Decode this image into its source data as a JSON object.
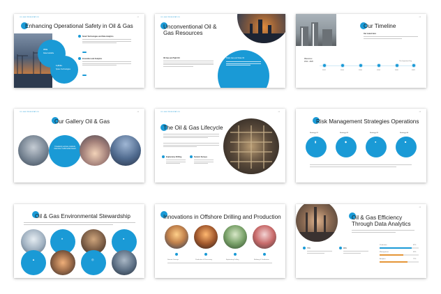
{
  "slides": [
    {
      "title": "Enhancing Operational Safety in Oil & Gas",
      "circle_a": {
        "value": "70%",
        "caption": "Data Available"
      },
      "circle_b": {
        "value": "1,212+",
        "caption": "Spare Technologies"
      },
      "points": [
        "Smart Technologies and Data Analytics",
        "Innovation and Analytics"
      ]
    },
    {
      "title": "Unconventional Oil & Gas Resources",
      "heading": "Oil Gas and Tight Oil",
      "circle_caption": "Shale Gas and Shale Oil"
    },
    {
      "title": "Our Timeline",
      "subtitle": "Our Latest Here",
      "milestone_label": "Milestones",
      "milestone_range": "2012 - 2026",
      "last_label": "The Important Day",
      "nodes": [
        "2012",
        "2014",
        "2016",
        "2018",
        "2020",
        "2022"
      ]
    },
    {
      "title": "Our Gallery Oil & Gas",
      "circle_text": "Creatively across markets intensive multimedia based"
    },
    {
      "title": "The Oil & Gas Lifecycle",
      "steps": [
        "Exploratory Drilling",
        "Production & Processing",
        "Seismic Surveys"
      ]
    },
    {
      "title": "Risk Management Strategies Operations",
      "strategies": [
        "Strategy 01",
        "Strategy 02",
        "Strategy 03",
        "Strategy 04"
      ]
    },
    {
      "title": "Oil & Gas Environmental Stewardship"
    },
    {
      "title": "Innovations in Offshore Drilling and Production",
      "captions": [
        "Seismic Surveys",
        "Production & Processing",
        "Exploratory Drilling",
        "Refining & Distribution"
      ]
    },
    {
      "title": "Oil & Gas Efficiency Through Data Analytics",
      "stats": [
        "70%",
        "90%"
      ],
      "bars": [
        {
          "label": "Production",
          "value": 0.82,
          "text": "82%"
        },
        {
          "label": "Management",
          "value": 0.6,
          "text": "60%"
        },
        {
          "label": "Analytics",
          "value": 0.72,
          "text": "72%"
        }
      ]
    }
  ],
  "colors": {
    "accent": "#1a9ad6",
    "text": "#1d1d1d",
    "shadow": "#cfcfcf"
  }
}
